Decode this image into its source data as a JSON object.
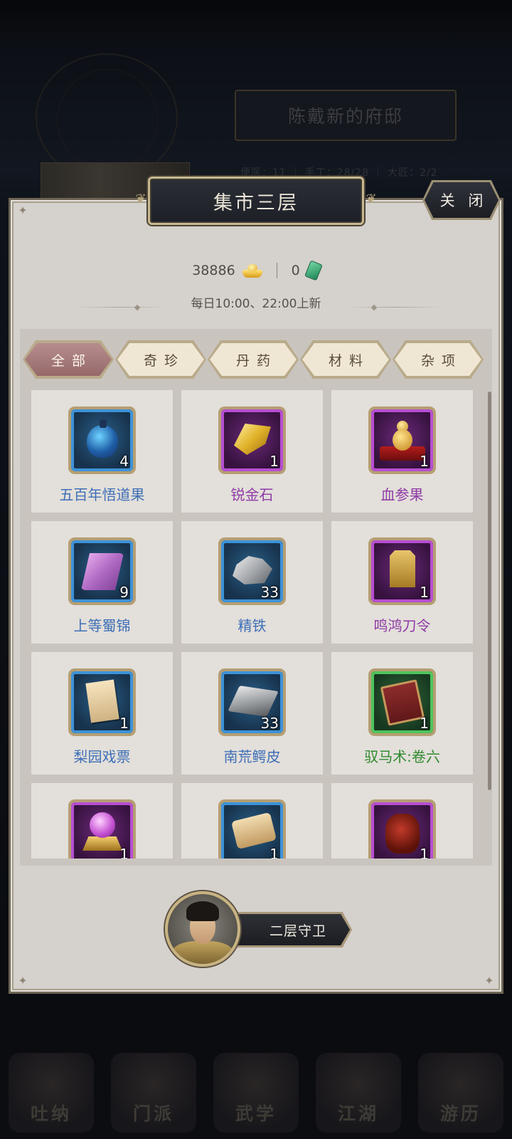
{
  "background": {
    "residence_title": "陈戴新的府邸",
    "stats_text": "便医：11 ｜ 手工：28/28 ｜ 大匠：2/2",
    "nav": [
      "吐纳",
      "门派",
      "武学",
      "江湖",
      "游历"
    ]
  },
  "dialog": {
    "title": "集市三层",
    "close_label": "关 闭",
    "currency": {
      "gold_amount": "38886",
      "jade_amount": "0"
    },
    "refresh_note": "每日10:00、22:00上新"
  },
  "tabs": [
    {
      "label": "全部",
      "active": true
    },
    {
      "label": "奇珍",
      "active": false
    },
    {
      "label": "丹药",
      "active": false
    },
    {
      "label": "材料",
      "active": false
    },
    {
      "label": "杂项",
      "active": false
    }
  ],
  "items": [
    {
      "name": "五百年悟道果",
      "count": "4",
      "rarity": "blue",
      "icon": "blue-fruit-icon"
    },
    {
      "name": "锐金石",
      "count": "1",
      "rarity": "purple",
      "icon": "gold-ore-icon"
    },
    {
      "name": "血参果",
      "count": "1",
      "rarity": "purple",
      "icon": "golden-gourd-icon"
    },
    {
      "name": "上等蜀锦",
      "count": "9",
      "rarity": "blue",
      "icon": "silk-roll-icon"
    },
    {
      "name": "精铁",
      "count": "33",
      "rarity": "blue",
      "icon": "iron-ore-icon"
    },
    {
      "name": "鸣鸿刀令",
      "count": "1",
      "rarity": "purple",
      "icon": "bronze-token-icon"
    },
    {
      "name": "梨园戏票",
      "count": "1",
      "rarity": "blue",
      "icon": "ticket-icon"
    },
    {
      "name": "南荒鳄皮",
      "count": "33",
      "rarity": "blue",
      "icon": "crocodile-hide-icon"
    },
    {
      "name": "驭马术:卷六",
      "count": "1",
      "rarity": "green",
      "icon": "manual-book-icon"
    },
    {
      "name": "",
      "count": "1",
      "rarity": "purple",
      "icon": "purple-orb-icon"
    },
    {
      "name": "",
      "count": "1",
      "rarity": "blue",
      "icon": "scroll-icon"
    },
    {
      "name": "",
      "count": "1",
      "rarity": "purple",
      "icon": "wine-jar-icon"
    }
  ],
  "guard": {
    "label": "二层守卫",
    "icon": "guard-portrait"
  },
  "colors": {
    "panel_bg": "#d5d1cc",
    "active_tab": "#a57878",
    "rarity_blue": "#3d93d8",
    "rarity_purple": "#b74fd2",
    "rarity_green": "#4fc45c"
  }
}
